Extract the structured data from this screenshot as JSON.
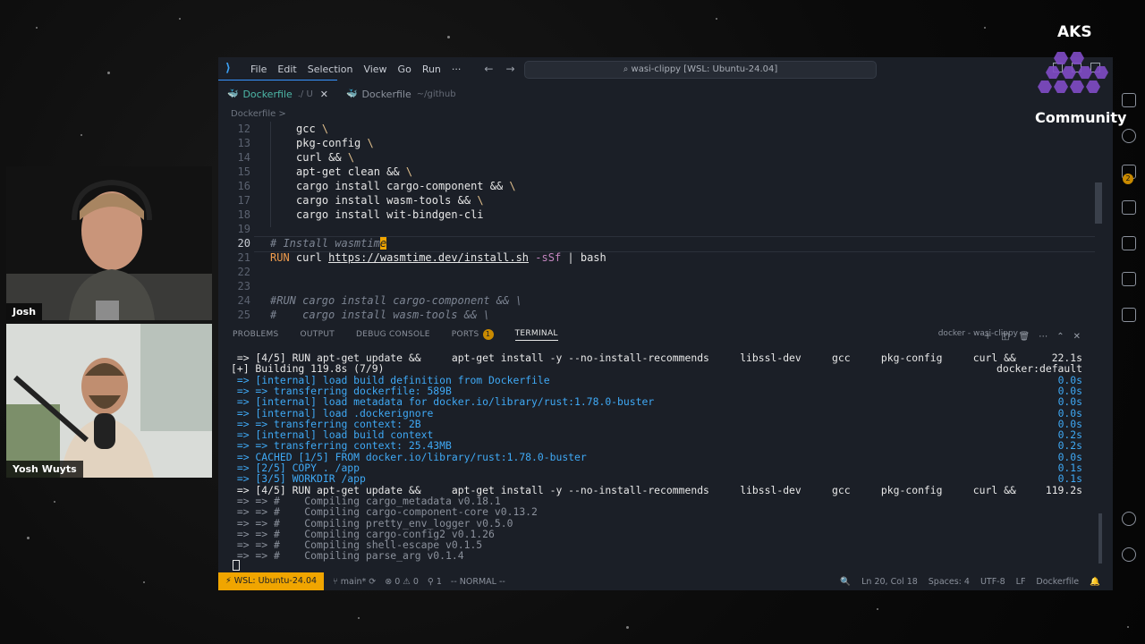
{
  "titlebar": {
    "menu": [
      "File",
      "Edit",
      "Selection",
      "View",
      "Go",
      "Run",
      "···"
    ],
    "command_center": "wasi-clippy [WSL: Ubuntu-24.04]"
  },
  "tabs": [
    {
      "label": "Dockerfile",
      "suffix": "./ U",
      "active": true
    },
    {
      "label": "Dockerfile",
      "suffix": "~/github",
      "active": false
    }
  ],
  "breadcrumb": "Dockerfile >",
  "editor": {
    "lines": [
      {
        "num": "12",
        "text": "    gcc \\"
      },
      {
        "num": "13",
        "text": "    pkg-config \\"
      },
      {
        "num": "14",
        "text": "    curl && \\"
      },
      {
        "num": "15",
        "text": "    apt-get clean && \\"
      },
      {
        "num": "16",
        "text": "    cargo install cargo-component && \\"
      },
      {
        "num": "17",
        "text": "    cargo install wasm-tools && \\"
      },
      {
        "num": "18",
        "text": "    cargo install wit-bindgen-cli"
      },
      {
        "num": "19",
        "text": ""
      },
      {
        "num": "20",
        "text": "# Install wasmtime"
      },
      {
        "num": "21",
        "text": "RUN curl https://wasmtime.dev/install.sh -sSf | bash"
      },
      {
        "num": "22",
        "text": ""
      },
      {
        "num": "23",
        "text": ""
      },
      {
        "num": "24",
        "text": "#RUN cargo install cargo-component && \\"
      },
      {
        "num": "25",
        "text": "#    cargo install wasm-tools && \\"
      }
    ],
    "l12": "gcc",
    "l13": "pkg-config",
    "l14": "curl &&",
    "l15": "apt-get clean &&",
    "l16": "cargo install cargo-component &&",
    "l17": "cargo install wasm-tools &&",
    "l18": "cargo install wit-bindgen-cli",
    "l20a": "# Install wasmtim",
    "l20b": "e",
    "l21_run": "RUN",
    "l21_curl": "curl",
    "l21_url": "https://wasmtime.dev/install.sh",
    "l21_flag": "-sSf",
    "l21_pipe": "| bash",
    "l24": "#RUN cargo install cargo-component && \\",
    "l25": "#    cargo install wasm-tools && \\",
    "backslash": "\\"
  },
  "panel": {
    "tabs": [
      "PROBLEMS",
      "OUTPUT",
      "DEBUG CONSOLE",
      "PORTS",
      "TERMINAL"
    ],
    "ports_count": "1",
    "terminal_name": "docker - wasi-clippy"
  },
  "terminal": [
    {
      "text": " => [4/5] RUN apt-get update &&     apt-get install -y --no-install-recommends     libssl-dev     gcc     pkg-config     curl &&",
      "right": "22.1s",
      "color": "white"
    },
    {
      "text": "[+] Building 119.8s (7/9)",
      "right": "docker:default",
      "color": "white"
    },
    {
      "text": " => [internal] load build definition from Dockerfile",
      "right": "0.0s",
      "color": "blue"
    },
    {
      "text": " => => transferring dockerfile: 589B",
      "right": "0.0s",
      "color": "blue"
    },
    {
      "text": " => [internal] load metadata for docker.io/library/rust:1.78.0-buster",
      "right": "0.0s",
      "color": "blue"
    },
    {
      "text": " => [internal] load .dockerignore",
      "right": "0.0s",
      "color": "blue"
    },
    {
      "text": " => => transferring context: 2B",
      "right": "0.0s",
      "color": "blue"
    },
    {
      "text": " => [internal] load build context",
      "right": "0.2s",
      "color": "blue"
    },
    {
      "text": " => => transferring context: 25.43MB",
      "right": "0.2s",
      "color": "blue"
    },
    {
      "text": " => CACHED [1/5] FROM docker.io/library/rust:1.78.0-buster",
      "right": "0.0s",
      "color": "blue"
    },
    {
      "text": " => [2/5] COPY . /app",
      "right": "0.1s",
      "color": "blue"
    },
    {
      "text": " => [3/5] WORKDIR /app",
      "right": "0.1s",
      "color": "blue"
    },
    {
      "text": " => [4/5] RUN apt-get update &&     apt-get install -y --no-install-recommends     libssl-dev     gcc     pkg-config     curl &&",
      "right": "119.2s",
      "color": "white"
    },
    {
      "text": " => => #    Compiling cargo_metadata v0.18.1",
      "right": "",
      "color": "gray"
    },
    {
      "text": " => => #    Compiling cargo-component-core v0.13.2",
      "right": "",
      "color": "gray"
    },
    {
      "text": " => => #    Compiling pretty_env_logger v0.5.0",
      "right": "",
      "color": "gray"
    },
    {
      "text": " => => #    Compiling cargo-config2 v0.1.26",
      "right": "",
      "color": "gray"
    },
    {
      "text": " => => #    Compiling shell-escape v0.1.5",
      "right": "",
      "color": "gray"
    },
    {
      "text": " => => #    Compiling parse_arg v0.1.4",
      "right": "",
      "color": "gray"
    }
  ],
  "statusbar": {
    "remote": "WSL: Ubuntu-24.04",
    "branch": "main*",
    "problems": "⊗ 0 ⚠ 0",
    "ports": "1",
    "mode": "-- NORMAL --",
    "position": "Ln 20, Col 18",
    "spaces": "Spaces: 4",
    "encoding": "UTF-8",
    "eol": "LF",
    "language": "Dockerfile"
  },
  "cams": [
    {
      "name": "Josh"
    },
    {
      "name": "Yosh Wuyts"
    }
  ],
  "brand": {
    "title": "AKS",
    "subtitle": "Community"
  },
  "activity_badge": "2",
  "colors": {
    "accent": "#f0a500",
    "terminal_blue": "#3fa9f5",
    "brand_purple": "#7e4bc2"
  }
}
